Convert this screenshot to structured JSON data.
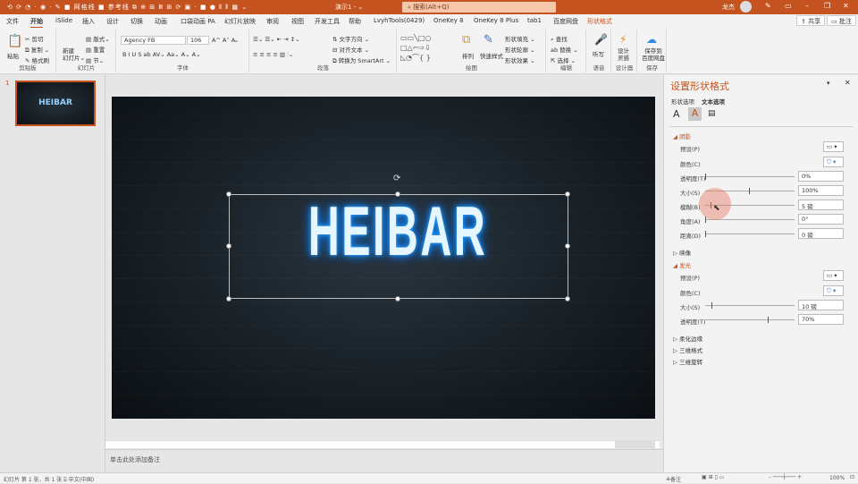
{
  "titlebar": {
    "quick_access": "⟲ ⟳ ◔ · ◉ · ✎ ■ 网格线 ■ 参考线 ⧉ ⊕ ⊞ Ⅲ ⊞ ⟳ ▣ · ■ ● ⫴ ⫴ ▦ ⌄",
    "doc": "演示1 - ⌄",
    "search": "⌕  搜索(Alt+Q)",
    "user": "龙杰",
    "share": "⇪ 共享",
    "comment": "▭ 批注"
  },
  "tabs": [
    "文件",
    "开始",
    "iSlide",
    "插入",
    "设计",
    "切换",
    "动画",
    "口袋动画 PA",
    "幻灯片放映",
    "审阅",
    "视图",
    "开发工具",
    "帮助",
    "LvyhTools(0429)",
    "OneKey 8",
    "OneKey 8 Plus",
    "tab1",
    "百度网盘",
    "形状格式"
  ],
  "ribbon": {
    "clipboard": {
      "label": "剪贴板",
      "paste": "粘贴",
      "cut": "✂ 剪切",
      "copy": "⧉ 复制 ⌄",
      "format": "✎ 格式刷"
    },
    "slides": {
      "label": "幻灯片",
      "new": "新建\n幻灯片⌄",
      "layout": "▤ 版式⌄",
      "reset": "▤ 重置",
      "section": "▤ 节⌄"
    },
    "font": {
      "label": "字体",
      "name": "Agency FB",
      "size": "106",
      "buttons": "B  I  U  S  ab  AV⌄  Aa⌄   A⌄  A⌄",
      "grow": "A^ A˅ Aₒ"
    },
    "paragraph": {
      "label": "段落",
      "row1": "☰⌄ ☰⌄ ⇤ ⇥ ↕⌄",
      "row2": "≡ ≡ ≡ ≡ ▥ ⫶⌄",
      "dir": "⇅ 文字方向 ⌄",
      "align": "⊟ 对齐文本 ⌄",
      "smartart": "⧉ 转换为 SmartArt ⌄"
    },
    "drawing": {
      "label": "绘图",
      "arrange": "排列",
      "styles": "快速样式",
      "fill": "形状填充 ⌄",
      "outline": "形状轮廓 ⌄",
      "effects": "形状效果 ⌄"
    },
    "editing": {
      "label": "编辑",
      "find": "⌕ 查找",
      "replace": "ab 替换 ⌄",
      "select": "⇱ 选择 ⌄"
    },
    "voice": {
      "label": "语音",
      "dictate": "听写"
    },
    "designer": {
      "label": "设计器",
      "ideas": "设计\n灵感"
    },
    "save": {
      "label": "保存",
      "baidu": "保存到\n百度网盘"
    }
  },
  "thumbnail": {
    "number": "1",
    "text": "HEIBAR"
  },
  "slide": {
    "text": "HEIBAR"
  },
  "notes": {
    "placeholder": "单击此处添加备注"
  },
  "pane": {
    "title": "设置形状格式",
    "tab1": "形状选项",
    "tab2": "文本选项",
    "shadow": {
      "label": "阴影",
      "preset": "预设(P)",
      "color": "颜色(C)",
      "transparency": "透明度(T)",
      "transparency_val": "0%",
      "size": "大小(S)",
      "size_val": "100%",
      "blur": "模糊(B)",
      "blur_val": "5 磅",
      "angle": "角度(A)",
      "angle_val": "0°",
      "distance": "距离(D)",
      "distance_val": "0 磅"
    },
    "reflection": "映像",
    "glow": {
      "label": "发光",
      "preset": "预设(P)",
      "color": "颜色(C)",
      "size": "大小(S)",
      "size_val": "10 磅",
      "transparency": "透明度(T)",
      "transparency_val": "70%"
    },
    "soft_edges": "柔化边缘",
    "format3d": "三维格式",
    "rotation3d": "三维旋转"
  },
  "status": {
    "left": "幻灯片 第 1 张，共 1 张   ⌸   中文(中国)",
    "notes": "≜备注",
    "zoom": "100%"
  }
}
